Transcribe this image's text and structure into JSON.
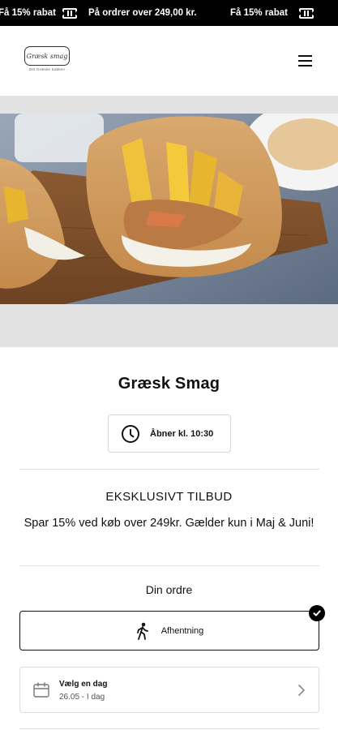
{
  "promo_bar": {
    "items": [
      "Få 15% rabat",
      "På ordrer over 249,00 kr.",
      "Få 15% rabat"
    ],
    "icon": "ticket-icon"
  },
  "header": {
    "logo_text": "Græsk smag",
    "logo_subtext": "Det Græske Køkken",
    "menu_icon": "hamburger-menu-icon"
  },
  "hero": {
    "alt": "Gyros pita med pommes frites"
  },
  "restaurant": {
    "name": "Græsk Smag",
    "hours": "Åbner kl. 10:30"
  },
  "offer": {
    "title": "EKSKLUSIVT TILBUD",
    "text": "Spar 15% ved køb over 249kr. Gælder kun i Maj & Juni!"
  },
  "order": {
    "title": "Din ordre",
    "pickup_label": "Afhentning",
    "day_picker": {
      "label": "Vælg en dag",
      "value": "26.05 - I dag"
    }
  },
  "colors": {
    "promo_bg": "#000000",
    "hero_frame": "#e2e2e2",
    "text": "#111111"
  }
}
